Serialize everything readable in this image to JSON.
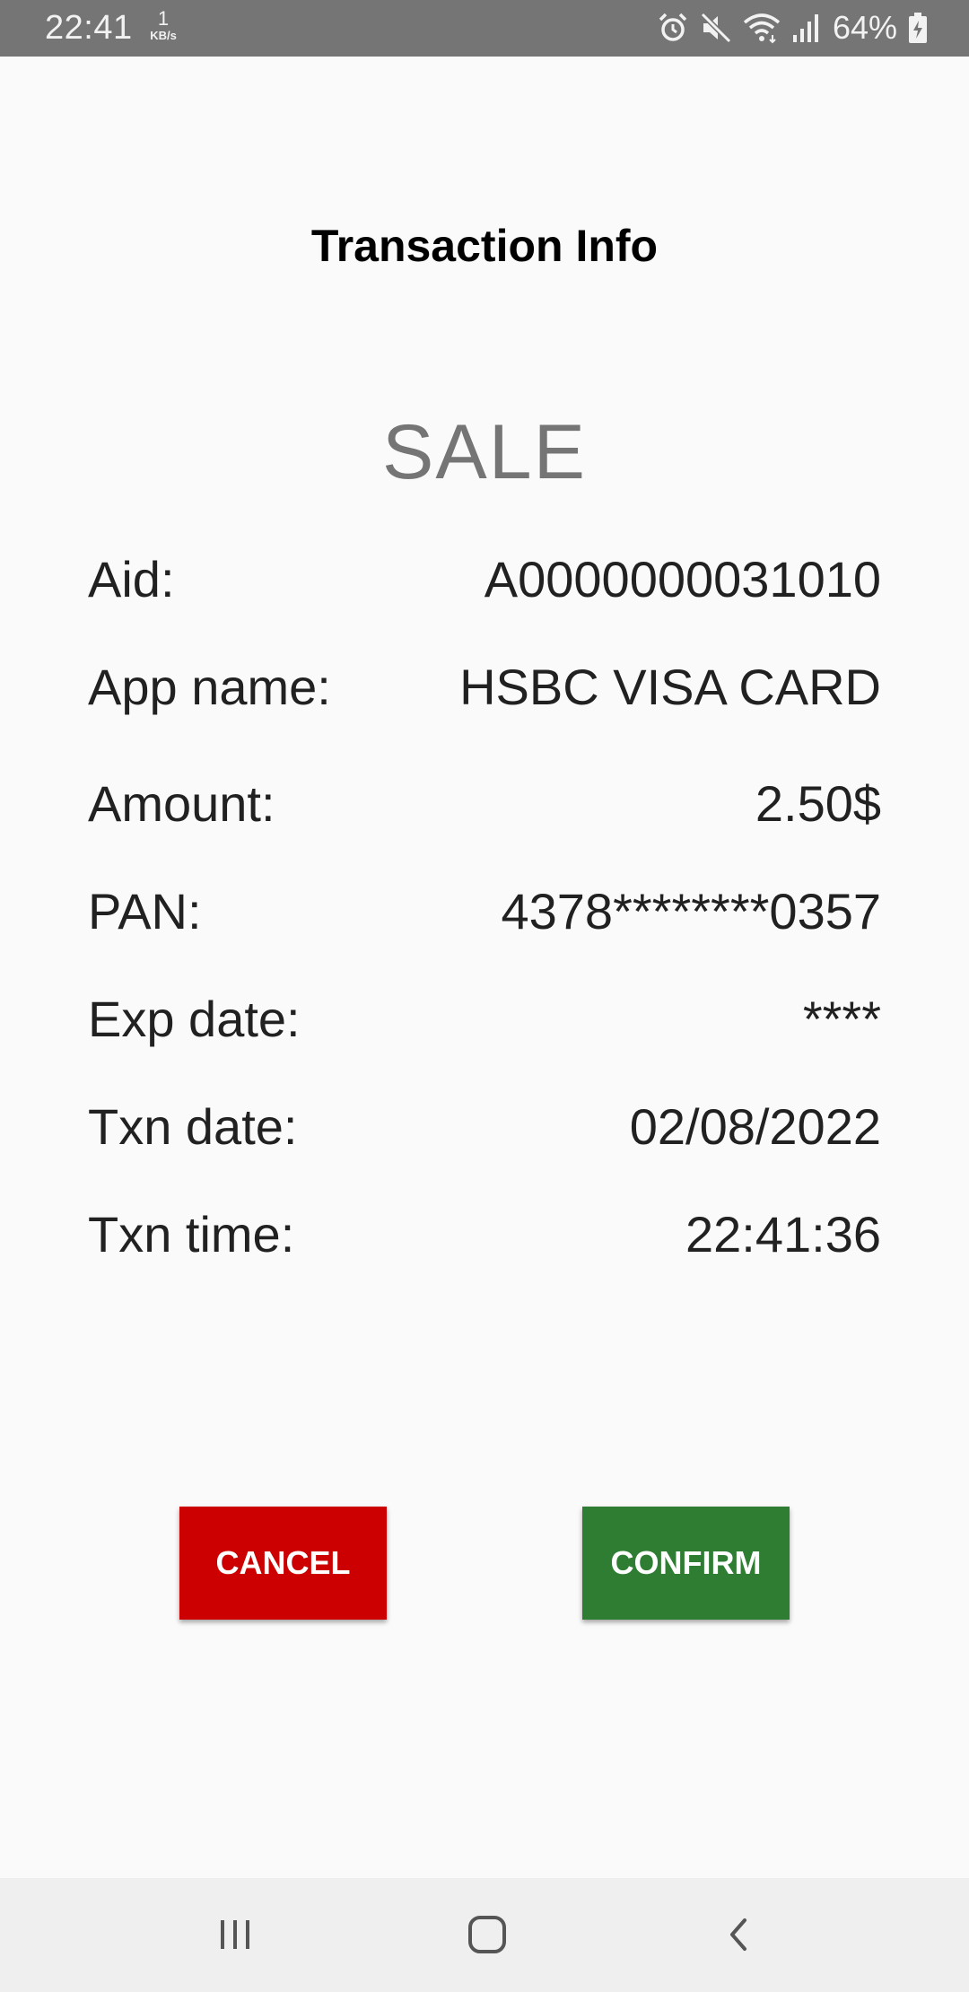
{
  "status_bar": {
    "time": "22:41",
    "net_speed_value": "1",
    "net_speed_unit": "KB/s",
    "battery_percent": "64%",
    "icons": [
      "alarm-icon",
      "mute-icon",
      "wifi-icon",
      "signal-icon",
      "battery-charging-icon"
    ]
  },
  "header": {
    "title": "Transaction Info"
  },
  "transaction": {
    "type": "SALE",
    "rows": [
      {
        "label": "Aid:",
        "value": "A0000000031010"
      },
      {
        "label": "App name:",
        "value": "HSBC VISA CARD"
      },
      {
        "label": "Amount:",
        "value": "2.50$"
      },
      {
        "label": "PAN:",
        "value": "4378********0357"
      },
      {
        "label": "Exp date:",
        "value": "****"
      },
      {
        "label": "Txn date:",
        "value": "02/08/2022"
      },
      {
        "label": "Txn time:",
        "value": "22:41:36"
      }
    ]
  },
  "actions": {
    "cancel_label": "CANCEL",
    "confirm_label": "CONFIRM",
    "cancel_color": "#cc0000",
    "confirm_color": "#2e7d32"
  },
  "nav_bar": {
    "icons": [
      "recents-icon",
      "home-icon",
      "back-icon"
    ]
  }
}
